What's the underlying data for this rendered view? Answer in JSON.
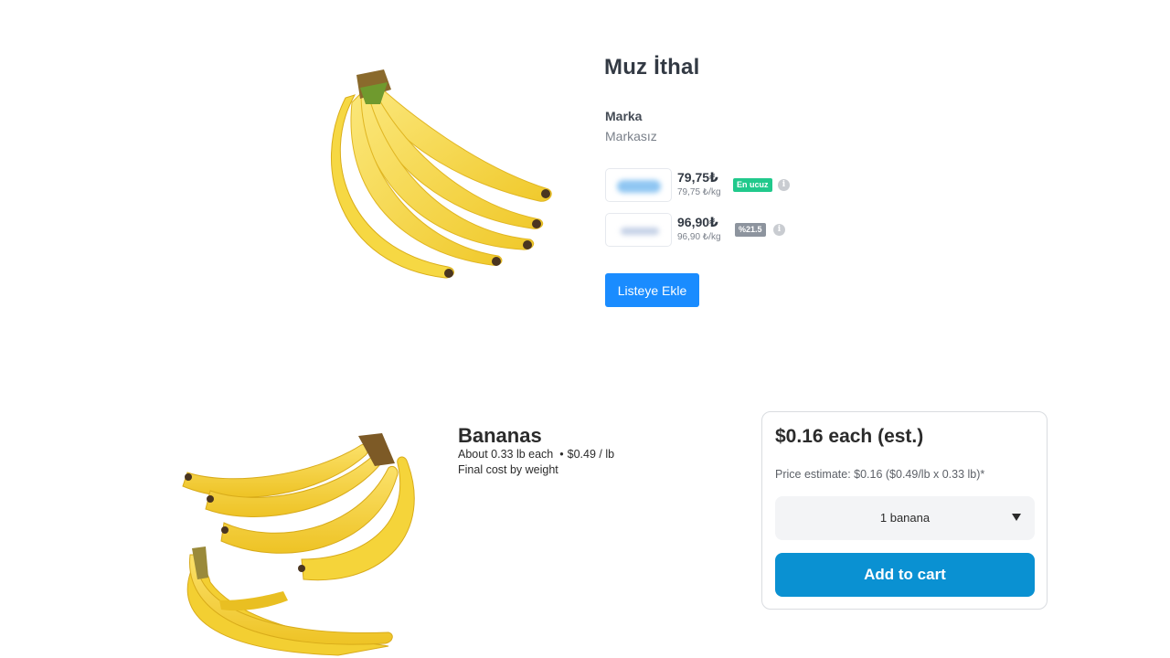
{
  "top_product": {
    "title": "Muz İthal",
    "brand_label": "Marka",
    "brand_value": "Markasız",
    "offers": [
      {
        "price": "79,75₺",
        "unit_price": "79,75 ₺/kg",
        "badge": "En ucuz",
        "badge_color": "#21c98c",
        "info_icon": "info-icon"
      },
      {
        "price": "96,90₺",
        "unit_price": "96,90 ₺/kg",
        "badge": "%21.5",
        "badge_color": "#8d949e",
        "info_icon": "info-icon"
      }
    ],
    "add_to_list_label": "Listeye Ekle",
    "accent_color": "#1a8cff"
  },
  "bottom_product": {
    "title": "Bananas",
    "size_text": "About 0.33 lb each",
    "separator": "•",
    "price_per_lb": "$0.49 / lb",
    "final_cost_note": "Final cost by weight",
    "card": {
      "price_each": "$0.16 each (est.)",
      "price_estimate": "Price estimate: $0.16 ($0.49/lb x 0.33 lb)*",
      "quantity_selected": "1 banana",
      "add_to_cart_label": "Add to cart",
      "button_color": "#0a91d2"
    }
  }
}
